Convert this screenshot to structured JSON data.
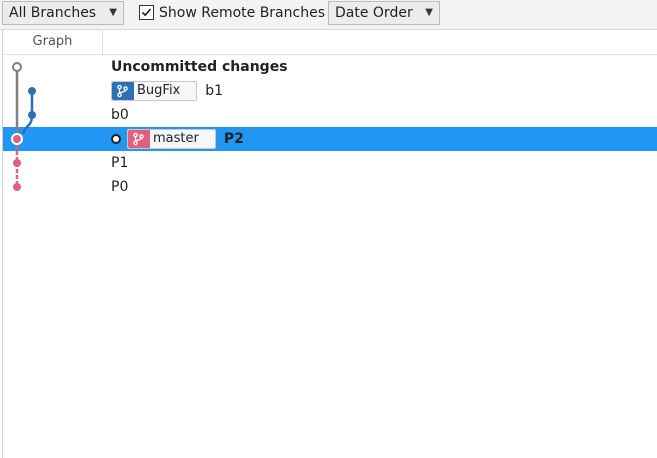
{
  "toolbar": {
    "branches_filter": "All Branches",
    "show_remote_label": "Show Remote Branches",
    "show_remote_checked": true,
    "order": "Date Order"
  },
  "columns": {
    "graph": "Graph"
  },
  "rows": [
    {
      "message": "Uncommitted changes"
    },
    {
      "branch": "BugFix",
      "message": "b1"
    },
    {
      "message": "b0"
    },
    {
      "branch": "master",
      "message": "P2"
    },
    {
      "message": "P1"
    },
    {
      "message": "P0"
    }
  ],
  "colors": {
    "selection": "#2196f3",
    "bugfix": "#2f6fb6",
    "master": "#e0607e",
    "uncommitted": "#808080"
  },
  "icons": {
    "dropdown": "chevron-down-icon",
    "check": "check-icon",
    "branch": "branch-icon"
  }
}
